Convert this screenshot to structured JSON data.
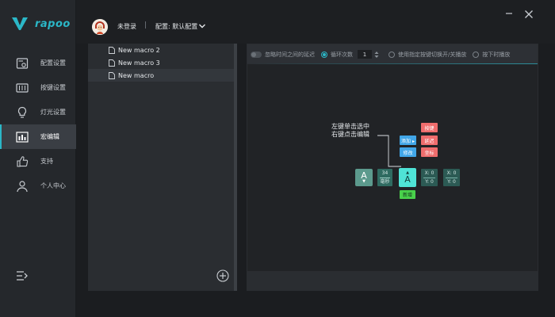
{
  "brand": {
    "name": "rapoo",
    "accent": "#2bb7c7"
  },
  "sidebar": {
    "items": [
      {
        "label": "配置设置",
        "icon": "config-icon",
        "active": false
      },
      {
        "label": "按键设置",
        "icon": "keyboard-icon",
        "active": false
      },
      {
        "label": "灯光设置",
        "icon": "lightbulb-icon",
        "active": false
      },
      {
        "label": "宏编辑",
        "icon": "macro-icon",
        "active": true
      },
      {
        "label": "支持",
        "icon": "thumbs-up-icon",
        "active": false
      },
      {
        "label": "个人中心",
        "icon": "user-icon",
        "active": false
      }
    ]
  },
  "header": {
    "user_status": "未登录",
    "separator": "|",
    "profile_label": "配置: 默认配置"
  },
  "macro_list": {
    "items": [
      "New macro 2",
      "New macro 3",
      "New macro"
    ]
  },
  "toolbar": {
    "ignore_delay": "忽略时间之间的延迟",
    "loop_count_label": "循环次数",
    "loop_count_value": "1",
    "toggle_mode": "使用指定按键切换开/关播放",
    "hold_mode": "按下时播放"
  },
  "tutorial": {
    "hint_line1": "左键单击选中",
    "hint_line2": "右键点击编辑",
    "menu_add": "添加 ▸",
    "menu_edit": "修改",
    "menu_key": "按键",
    "menu_delay": "延迟",
    "menu_coord": "坐标",
    "key_letter": "A",
    "delay_value": "34",
    "delay_unit": "毫秒",
    "coord1_x": "X: 0",
    "coord1_y": "Y: 0",
    "coord2_x": "X: 0",
    "coord2_y": "Y: 0",
    "new_label": "新增"
  }
}
